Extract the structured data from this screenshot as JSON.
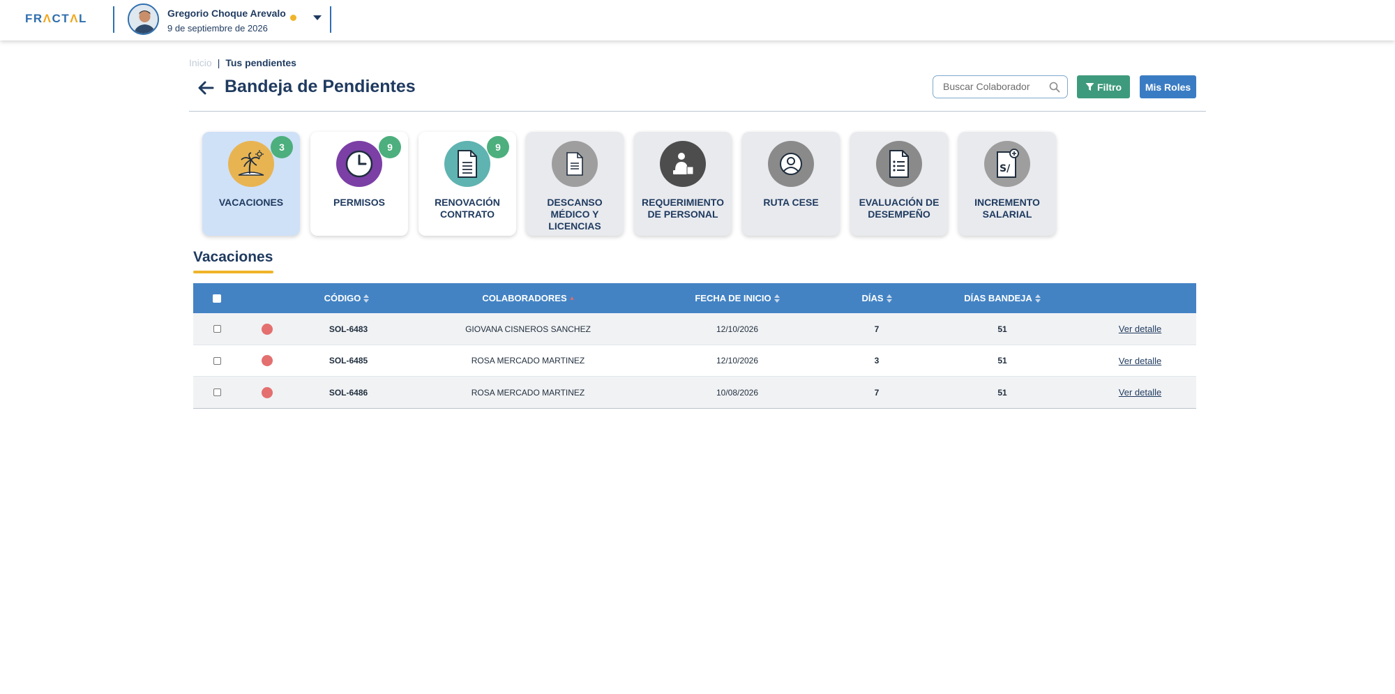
{
  "header": {
    "logo_prefix": "FR",
    "logo_a": "Λ",
    "logo_mid": "CT",
    "logo_a2": "Λ",
    "logo_suffix": "L",
    "user_name": "Gregorio Choque Arevalo",
    "user_date": "9 de septiembre de 2026",
    "status_color": "#f0b429"
  },
  "breadcrumb": {
    "home": "Inicio",
    "separator": "|",
    "current": "Tus pendientes"
  },
  "page": {
    "title": "Bandeja de Pendientes",
    "search_placeholder": "Buscar Colaborador",
    "filter_label": "Filtro",
    "roles_label": "Mis Roles"
  },
  "categories": [
    {
      "label": "VACACIONES",
      "badge": "3",
      "icon": "palm-tree-icon",
      "color": "#e8b452"
    },
    {
      "label": "PERMISOS",
      "badge": "9",
      "icon": "clock-icon",
      "color": "#7b3fa6"
    },
    {
      "label": "RENOVACIÓN CONTRATO",
      "badge": "9",
      "icon": "document-icon",
      "color": "#5fb3b0"
    },
    {
      "label": "DESCANSO MÉDICO Y LICENCIAS",
      "badge": "",
      "icon": "medical-document-icon",
      "color": "#9e9e9e"
    },
    {
      "label": "REQUERIMIENTO DE PERSONAL",
      "badge": "",
      "icon": "person-request-icon",
      "color": "#4d4d4d"
    },
    {
      "label": "RUTA CESE",
      "badge": "",
      "icon": "user-circle-icon",
      "color": "#8a8a8a"
    },
    {
      "label": "EVALUACIÓN DE DESEMPEÑO",
      "badge": "",
      "icon": "checklist-icon",
      "color": "#8a8a8a"
    },
    {
      "label": "INCREMENTO SALARIAL",
      "badge": "",
      "icon": "salary-icon",
      "color": "#9e9e9e"
    }
  ],
  "section": {
    "title": "Vacaciones"
  },
  "table": {
    "columns": [
      "CÓDIGO",
      "COLABORADORES",
      "FECHA DE INICIO",
      "DÍAS",
      "DÍAS BANDEJA"
    ],
    "rows": [
      {
        "code": "SOL-6483",
        "name": "GIOVANA CISNEROS SANCHEZ",
        "start": "12/10/2026",
        "days": "7",
        "tray_days": "51",
        "action": "Ver detalle"
      },
      {
        "code": "SOL-6485",
        "name": "ROSA MERCADO MARTINEZ",
        "start": "12/10/2026",
        "days": "3",
        "tray_days": "51",
        "action": "Ver detalle"
      },
      {
        "code": "SOL-6486",
        "name": "ROSA MERCADO MARTINEZ",
        "start": "10/08/2026",
        "days": "7",
        "tray_days": "51",
        "action": "Ver detalle"
      }
    ]
  }
}
